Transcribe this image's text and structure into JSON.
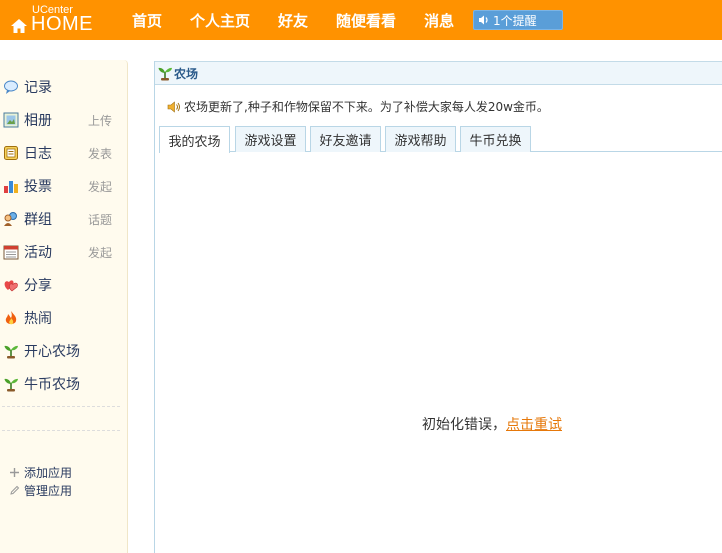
{
  "header": {
    "logo_small": "UCenter",
    "logo_big": "HOME",
    "nav": [
      "首页",
      "个人主页",
      "好友",
      "随便看看",
      "消息"
    ],
    "notice": "1个提醒"
  },
  "sidebar": {
    "items": [
      {
        "label": "记录",
        "action": "",
        "icon": "record-icon"
      },
      {
        "label": "相册",
        "action": "上传",
        "icon": "album-icon"
      },
      {
        "label": "日志",
        "action": "发表",
        "icon": "blog-icon"
      },
      {
        "label": "投票",
        "action": "发起",
        "icon": "poll-icon"
      },
      {
        "label": "群组",
        "action": "话题",
        "icon": "group-icon"
      },
      {
        "label": "活动",
        "action": "发起",
        "icon": "event-icon"
      },
      {
        "label": "分享",
        "action": "",
        "icon": "share-icon"
      },
      {
        "label": "热闹",
        "action": "",
        "icon": "hot-icon"
      },
      {
        "label": "开心农场",
        "action": "",
        "icon": "sprout-icon"
      },
      {
        "label": "牛币农场",
        "action": "",
        "icon": "sprout-icon"
      }
    ],
    "add_app": "添加应用",
    "manage_app": "管理应用"
  },
  "panel": {
    "title": "农场",
    "announcement": "农场更新了,种子和作物保留不下来。为了补偿大家每人发20w金币。",
    "tabs": [
      "我的农场",
      "游戏设置",
      "好友邀请",
      "游戏帮助",
      "牛币兑换"
    ],
    "active_tab": 0,
    "init_error": "初始化错误，",
    "retry": "点击重试"
  },
  "colors": {
    "header_bg": "#ff9200",
    "sidebar_bg": "#fffbee",
    "link_orange": "#e6780a",
    "panel_border": "#b9d6e6"
  }
}
